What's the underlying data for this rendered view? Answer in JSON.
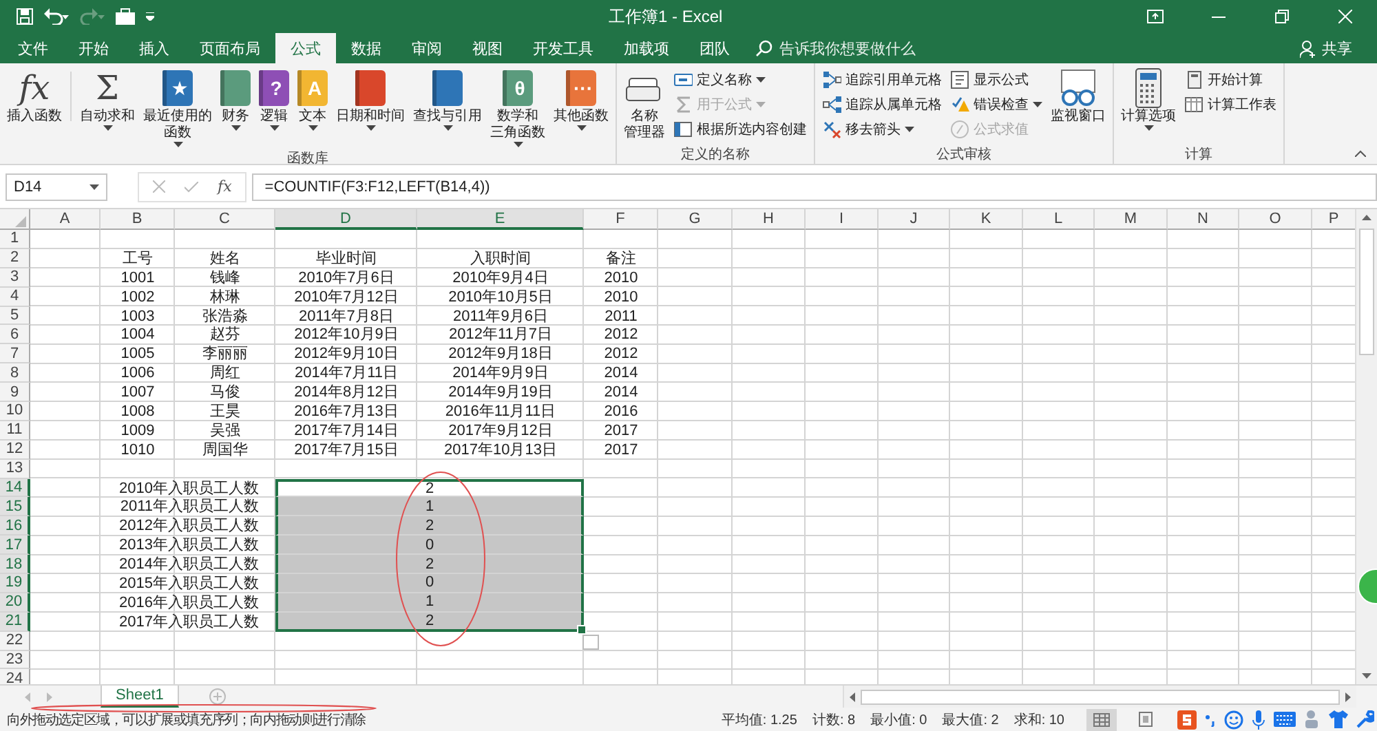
{
  "title_bar": {
    "title": "工作簿1 - Excel"
  },
  "menu_tabs": [
    {
      "label": "文件",
      "selected": false
    },
    {
      "label": "开始",
      "selected": false
    },
    {
      "label": "插入",
      "selected": false
    },
    {
      "label": "页面布局",
      "selected": false
    },
    {
      "label": "公式",
      "selected": true
    },
    {
      "label": "数据",
      "selected": false
    },
    {
      "label": "审阅",
      "selected": false
    },
    {
      "label": "视图",
      "selected": false
    },
    {
      "label": "开发工具",
      "selected": false
    },
    {
      "label": "加载项",
      "selected": false
    },
    {
      "label": "团队",
      "selected": false
    }
  ],
  "search": {
    "placeholder": "告诉我你想要做什么"
  },
  "share": "共享",
  "ribbon": {
    "groups": [
      {
        "label": "函数库",
        "items": [
          {
            "kind": "large",
            "lines": [
              "插入函数"
            ],
            "glyph": "fx",
            "dropdown": false
          },
          {
            "kind": "large",
            "lines": [
              "自动求和"
            ],
            "glyph": "Σ",
            "dropdown": true
          },
          {
            "kind": "large",
            "lines": [
              "最近使用的",
              "函数"
            ],
            "glyph": "★",
            "color": "#2e75b6",
            "dropdown": true
          },
          {
            "kind": "large",
            "lines": [
              "财务"
            ],
            "color": "#5b9b7d",
            "dropdown": true
          },
          {
            "kind": "large",
            "lines": [
              "逻辑"
            ],
            "glyph": "?",
            "color": "#8e4fb5",
            "dropdown": true
          },
          {
            "kind": "large",
            "lines": [
              "文本"
            ],
            "glyph": "A",
            "color": "#f2b632",
            "dropdown": true
          },
          {
            "kind": "large",
            "lines": [
              "日期和时间"
            ],
            "color": "#d9472b",
            "dropdown": true
          },
          {
            "kind": "large",
            "lines": [
              "查找与引用"
            ],
            "color": "#2e75b6",
            "dropdown": true
          },
          {
            "kind": "large",
            "lines": [
              "数学和",
              "三角函数"
            ],
            "glyph": "θ",
            "color": "#5b9b7d",
            "dropdown": true
          },
          {
            "kind": "large",
            "lines": [
              "其他函数"
            ],
            "glyph": "···",
            "color": "#e8743b",
            "dropdown": true
          }
        ]
      },
      {
        "label": "定义的名称",
        "items": [
          {
            "kind": "large",
            "lines": [
              "名称",
              "管理器"
            ],
            "dropdown": false
          },
          {
            "kind": "small",
            "label": "定义名称",
            "dropdown": true,
            "disabled": false
          },
          {
            "kind": "small",
            "label": "用于公式",
            "dropdown": true,
            "disabled": true
          },
          {
            "kind": "small",
            "label": "根据所选内容创建",
            "dropdown": false,
            "disabled": false
          }
        ]
      },
      {
        "label": "公式审核",
        "items": [
          {
            "kind": "small",
            "label": "追踪引用单元格",
            "dropdown": false,
            "disabled": false
          },
          {
            "kind": "small",
            "label": "追踪从属单元格",
            "dropdown": false,
            "disabled": false
          },
          {
            "kind": "small",
            "label": "移去箭头",
            "dropdown": true,
            "disabled": false
          },
          {
            "kind": "small",
            "label": "显示公式",
            "dropdown": false,
            "disabled": false
          },
          {
            "kind": "small",
            "label": "错误检查",
            "dropdown": true,
            "disabled": false
          },
          {
            "kind": "small",
            "label": "公式求值",
            "dropdown": false,
            "disabled": true
          },
          {
            "kind": "large",
            "lines": [
              "监视窗口"
            ],
            "dropdown": false
          }
        ]
      },
      {
        "label": "计算",
        "items": [
          {
            "kind": "large",
            "lines": [
              "计算选项"
            ],
            "dropdown": true
          },
          {
            "kind": "small",
            "label": "开始计算",
            "dropdown": false,
            "disabled": false
          },
          {
            "kind": "small",
            "label": "计算工作表",
            "dropdown": false,
            "disabled": false
          }
        ]
      }
    ]
  },
  "formula_bar": {
    "name_box": "D14",
    "fx": "fx",
    "formula": "=COUNTIF(F3:F12,LEFT(B14,4))"
  },
  "sheet": {
    "columns": [
      {
        "label": "A",
        "selected": false
      },
      {
        "label": "B",
        "selected": false
      },
      {
        "label": "C",
        "selected": false
      },
      {
        "label": "D",
        "selected": true
      },
      {
        "label": "E",
        "selected": true
      },
      {
        "label": "F",
        "selected": false
      },
      {
        "label": "G",
        "selected": false
      },
      {
        "label": "H",
        "selected": false
      },
      {
        "label": "I",
        "selected": false
      },
      {
        "label": "J",
        "selected": false
      },
      {
        "label": "K",
        "selected": false
      },
      {
        "label": "L",
        "selected": false
      },
      {
        "label": "M",
        "selected": false
      },
      {
        "label": "N",
        "selected": false
      },
      {
        "label": "O",
        "selected": false
      },
      {
        "label": "P",
        "selected": false
      }
    ],
    "rows": [
      {
        "number": "1",
        "selected": false,
        "kind": "empty"
      },
      {
        "number": "2",
        "selected": false,
        "kind": "data",
        "cells": [
          "工号",
          "姓名",
          "毕业时间",
          "入职时间",
          "备注"
        ]
      },
      {
        "number": "3",
        "selected": false,
        "kind": "data",
        "cells": [
          "1001",
          "钱峰",
          "2010年7月6日",
          "2010年9月4日",
          "2010"
        ]
      },
      {
        "number": "4",
        "selected": false,
        "kind": "data",
        "cells": [
          "1002",
          "林琳",
          "2010年7月12日",
          "2010年10月5日",
          "2010"
        ]
      },
      {
        "number": "5",
        "selected": false,
        "kind": "data",
        "cells": [
          "1003",
          "张浩淼",
          "2011年7月8日",
          "2011年9月6日",
          "2011"
        ]
      },
      {
        "number": "6",
        "selected": false,
        "kind": "data",
        "cells": [
          "1004",
          "赵芬",
          "2012年10月9日",
          "2012年11月7日",
          "2012"
        ]
      },
      {
        "number": "7",
        "selected": false,
        "kind": "data",
        "cells": [
          "1005",
          "李丽丽",
          "2012年9月10日",
          "2012年9月18日",
          "2012"
        ]
      },
      {
        "number": "8",
        "selected": false,
        "kind": "data",
        "cells": [
          "1006",
          "周红",
          "2014年7月11日",
          "2014年9月9日",
          "2014"
        ]
      },
      {
        "number": "9",
        "selected": false,
        "kind": "data",
        "cells": [
          "1007",
          "马俊",
          "2014年8月12日",
          "2014年9月19日",
          "2014"
        ]
      },
      {
        "number": "10",
        "selected": false,
        "kind": "data",
        "cells": [
          "1008",
          "王昊",
          "2016年7月13日",
          "2016年11月11日",
          "2016"
        ]
      },
      {
        "number": "11",
        "selected": false,
        "kind": "data",
        "cells": [
          "1009",
          "吴强",
          "2017年7月14日",
          "2017年9月12日",
          "2017"
        ]
      },
      {
        "number": "12",
        "selected": false,
        "kind": "data",
        "cells": [
          "1010",
          "周国华",
          "2017年7月15日",
          "2017年10月13日",
          "2017"
        ]
      },
      {
        "number": "13",
        "selected": false,
        "kind": "empty"
      },
      {
        "number": "14",
        "selected": true,
        "kind": "summary",
        "label": "2010年入职员工人数",
        "value": "2",
        "active": true
      },
      {
        "number": "15",
        "selected": true,
        "kind": "summary",
        "label": "2011年入职员工人数",
        "value": "1",
        "active": false
      },
      {
        "number": "16",
        "selected": true,
        "kind": "summary",
        "label": "2012年入职员工人数",
        "value": "2",
        "active": false
      },
      {
        "number": "17",
        "selected": true,
        "kind": "summary",
        "label": "2013年入职员工人数",
        "value": "0",
        "active": false
      },
      {
        "number": "18",
        "selected": true,
        "kind": "summary",
        "label": "2014年入职员工人数",
        "value": "2",
        "active": false
      },
      {
        "number": "19",
        "selected": true,
        "kind": "summary",
        "label": "2015年入职员工人数",
        "value": "0",
        "active": false
      },
      {
        "number": "20",
        "selected": true,
        "kind": "summary",
        "label": "2016年入职员工人数",
        "value": "1",
        "active": false
      },
      {
        "number": "21",
        "selected": true,
        "kind": "summary",
        "label": "2017年入职员工人数",
        "value": "2",
        "active": false
      },
      {
        "number": "22",
        "selected": false,
        "kind": "empty"
      },
      {
        "number": "23",
        "selected": false,
        "kind": "empty"
      },
      {
        "number": "24",
        "selected": false,
        "kind": "empty"
      }
    ]
  },
  "sheet_tabs": [
    {
      "label": "Sheet1",
      "selected": true
    }
  ],
  "status_bar": {
    "message": "向外拖动选定区域，可以扩展或填充序列；向内拖动则进行清除",
    "stats": [
      "平均值: 1.25",
      "计数: 8",
      "最小值: 0",
      "最大值: 2",
      "求和: 10"
    ],
    "views": [
      {
        "selected": true
      },
      {
        "selected": false
      }
    ]
  }
}
